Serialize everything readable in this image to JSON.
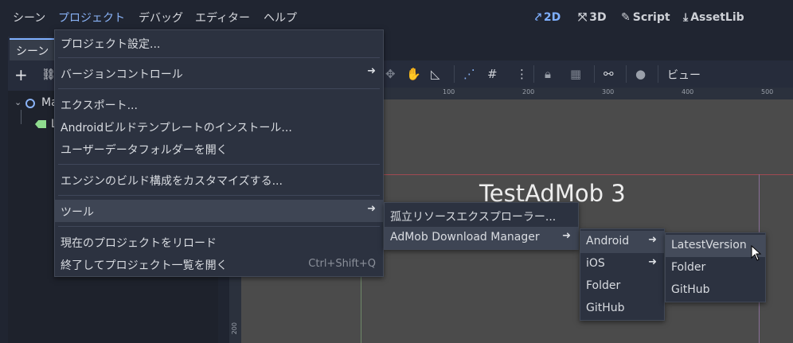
{
  "menubar": {
    "items": [
      "シーン",
      "プロジェクト",
      "デバッグ",
      "エディター",
      "ヘルプ"
    ],
    "modes": [
      {
        "label": "2D",
        "icon": "2d-icon"
      },
      {
        "label": "3D",
        "icon": "3d-icon"
      },
      {
        "label": "Script",
        "icon": "script-icon"
      },
      {
        "label": "AssetLib",
        "icon": "assetlib-icon"
      }
    ]
  },
  "dock": {
    "tab_label": "シーン",
    "tree_root_label": "Ma",
    "tree_child_label": "L"
  },
  "viewport": {
    "view_label": "ビュー",
    "ruler_ticks": [
      "100",
      "200",
      "300",
      "400",
      "500"
    ],
    "ruler_left_tick": "200",
    "scene_title": "TestAdMob 3"
  },
  "project_menu": {
    "items": [
      {
        "label": "プロジェクト設定..."
      },
      {
        "label": "バージョンコントロール",
        "submenu": true
      },
      {
        "label": "エクスポート..."
      },
      {
        "label": "Androidビルドテンプレートのインストール..."
      },
      {
        "label": "ユーザーデータフォルダーを開く"
      },
      {
        "label": "エンジンのビルド構成をカスタマイズする..."
      },
      {
        "label": "ツール",
        "submenu": true
      },
      {
        "label": "現在のプロジェクトをリロード"
      },
      {
        "label": "終了してプロジェクト一覧を開く",
        "shortcut": "Ctrl+Shift+Q"
      }
    ]
  },
  "tools_menu": {
    "items": [
      {
        "label": "孤立リソースエクスプローラー..."
      },
      {
        "label": "AdMob Download Manager",
        "submenu": true
      }
    ]
  },
  "admob_menu": {
    "items": [
      {
        "label": "Android",
        "submenu": true
      },
      {
        "label": "iOS",
        "submenu": true
      },
      {
        "label": "Folder"
      },
      {
        "label": "GitHub"
      }
    ]
  },
  "android_menu": {
    "items": [
      {
        "label": "LatestVersion"
      },
      {
        "label": "Folder"
      },
      {
        "label": "GitHub"
      }
    ]
  },
  "colors": {
    "accent": "#7fb0ff",
    "menu_bg": "#2c3240",
    "viewport_bg": "#4b4b4b"
  }
}
